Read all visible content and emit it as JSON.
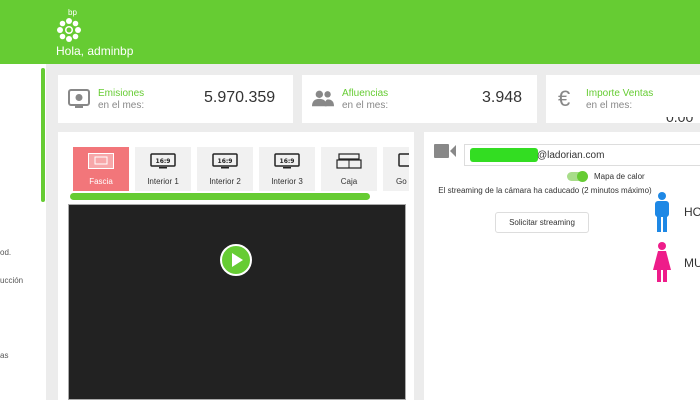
{
  "header": {
    "logo_text": "bp",
    "greeting": "Hola, adminbp",
    "brand_color": "#66cc33"
  },
  "sidebar": {
    "items": [
      {
        "label": "od."
      },
      {
        "label": "ucción"
      },
      {
        "label": "as"
      }
    ]
  },
  "stats": [
    {
      "label_line1": "Emisiones",
      "label_line2": "en el mes:",
      "value": "5.970.359",
      "icon": "tv-icon"
    },
    {
      "label_line1": "Afluencias",
      "label_line2": "en el mes:",
      "value": "3.948",
      "icon": "people-icon"
    },
    {
      "label_line1": "Importe Ventas",
      "label_line2": "en el mes:",
      "value": "",
      "icon": "euro-icon"
    }
  ],
  "camera_tabs": [
    {
      "label": "Fascia",
      "active": true,
      "icon": "fascia-icon"
    },
    {
      "label": "Interior 1",
      "active": false,
      "icon": "tv-169-icon",
      "badge": "16:9"
    },
    {
      "label": "Interior 2",
      "active": false,
      "icon": "tv-169-icon",
      "badge": "16:9"
    },
    {
      "label": "Interior 3",
      "active": false,
      "icon": "tv-169-icon",
      "badge": "16:9"
    },
    {
      "label": "Caja",
      "active": false,
      "icon": "cash-register-icon"
    },
    {
      "label": "Go",
      "active": false,
      "icon": "tv-icon"
    }
  ],
  "stream": {
    "email_suffix": "@ladorian.com",
    "heatmap_label": "Mapa de calor",
    "heatmap_on": true,
    "expired_message": "El streaming de la cámara ha caducado (2 minutos máximo)",
    "request_button": "Solicitar streaming"
  },
  "gender": {
    "male_label": "HO",
    "female_label": "MU",
    "male_color": "#1e88e5",
    "female_color": "#ee1d8a"
  },
  "colors": {
    "active_tab": "#f2767a",
    "video_bg": "#222222"
  }
}
